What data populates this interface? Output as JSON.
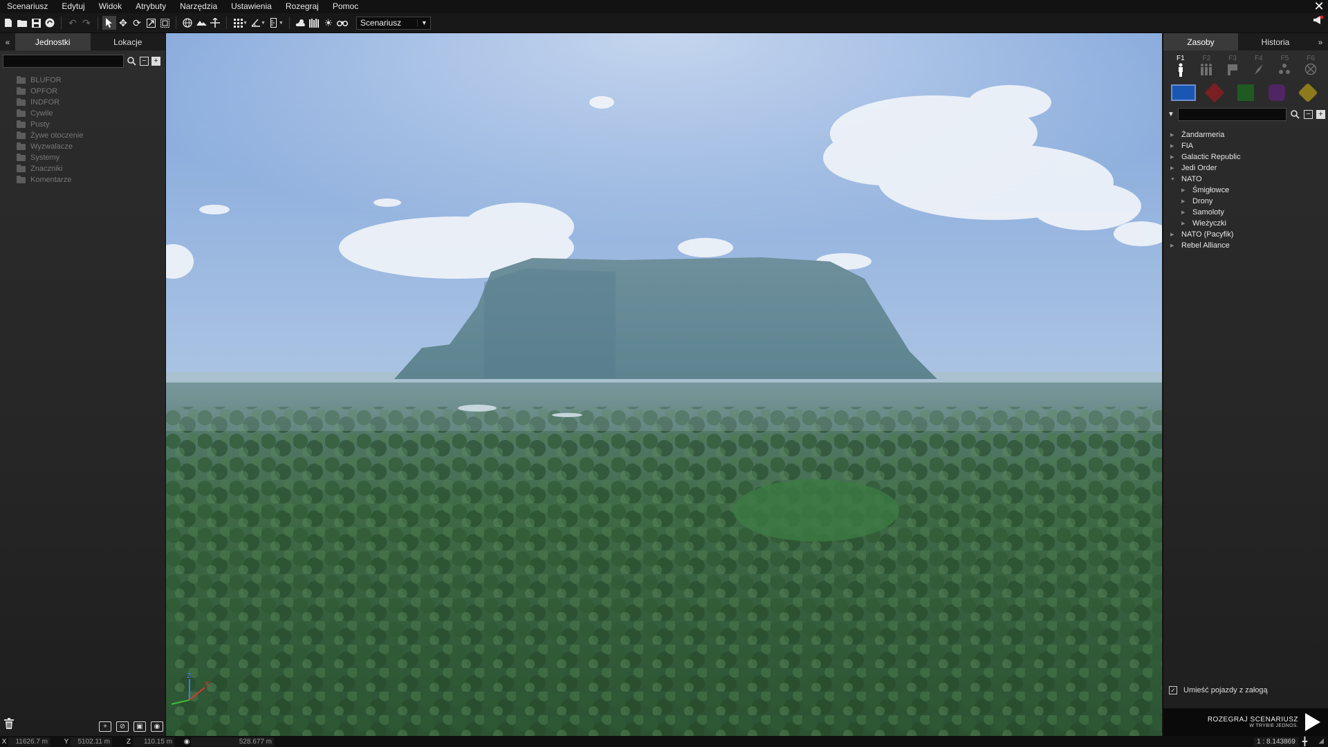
{
  "menu": [
    "Scenariusz",
    "Edytuj",
    "Widok",
    "Atrybuty",
    "Narzędzia",
    "Ustawienia",
    "Rozegraj",
    "Pomoc"
  ],
  "toolbar": {
    "mode_select": "Scenariusz"
  },
  "left_panel": {
    "collapse_arrow": "«",
    "tabs": [
      "Jednostki",
      "Lokacje"
    ],
    "search_value": "",
    "tree": [
      "BLUFOR",
      "OPFOR",
      "INDFOR",
      "Cywile",
      "Pusty",
      "Żywe otoczenie",
      "Wyzwalacze",
      "Systemy",
      "Znaczniki",
      "Komentarze"
    ]
  },
  "right_panel": {
    "expand_arrow": "»",
    "tabs": [
      "Zasoby",
      "Historia"
    ],
    "fkeys": [
      "F1",
      "F2",
      "F3",
      "F4",
      "F5",
      "F6"
    ],
    "sides": {
      "blufor_color": "#1a57b5",
      "opfor_color": "#7a1f22",
      "indfor_color": "#1f5a22",
      "civilian_color": "#4f2563",
      "empty_color": "#8d7a1c"
    },
    "search_value": "",
    "tree": [
      {
        "label": "Żandarmeria",
        "expanded": false,
        "level": 0
      },
      {
        "label": "FIA",
        "expanded": false,
        "level": 0
      },
      {
        "label": "Galactic Republic",
        "expanded": false,
        "level": 0
      },
      {
        "label": "Jedi Order",
        "expanded": false,
        "level": 0
      },
      {
        "label": "NATO",
        "expanded": true,
        "level": 0
      },
      {
        "label": "Śmigłowce",
        "expanded": false,
        "level": 1
      },
      {
        "label": "Drony",
        "expanded": false,
        "level": 1
      },
      {
        "label": "Samoloty",
        "expanded": false,
        "level": 1
      },
      {
        "label": "Wieżyczki",
        "expanded": false,
        "level": 1
      },
      {
        "label": "NATO (Pacyfik)",
        "expanded": false,
        "level": 0
      },
      {
        "label": "Rebel Alliance",
        "expanded": false,
        "level": 0
      }
    ],
    "crew_checkbox_label": "Umieść pojazdy z załogą",
    "crew_checked": true,
    "play": {
      "title": "ROZEGRAJ SCENARIUSZ",
      "subtitle": "W TRYBIE JEDNOS."
    }
  },
  "viewport": {
    "gizmo_axes": [
      "Z",
      "X"
    ]
  },
  "statusbar": {
    "x_label": "X",
    "x_value": "11626.7 m",
    "y_label": "Y",
    "y_value": "5102.11 m",
    "z_label": "Z",
    "z_value": "110.15 m",
    "distance_value": "528.677 m",
    "scale_value": "1 : 8.143869"
  }
}
